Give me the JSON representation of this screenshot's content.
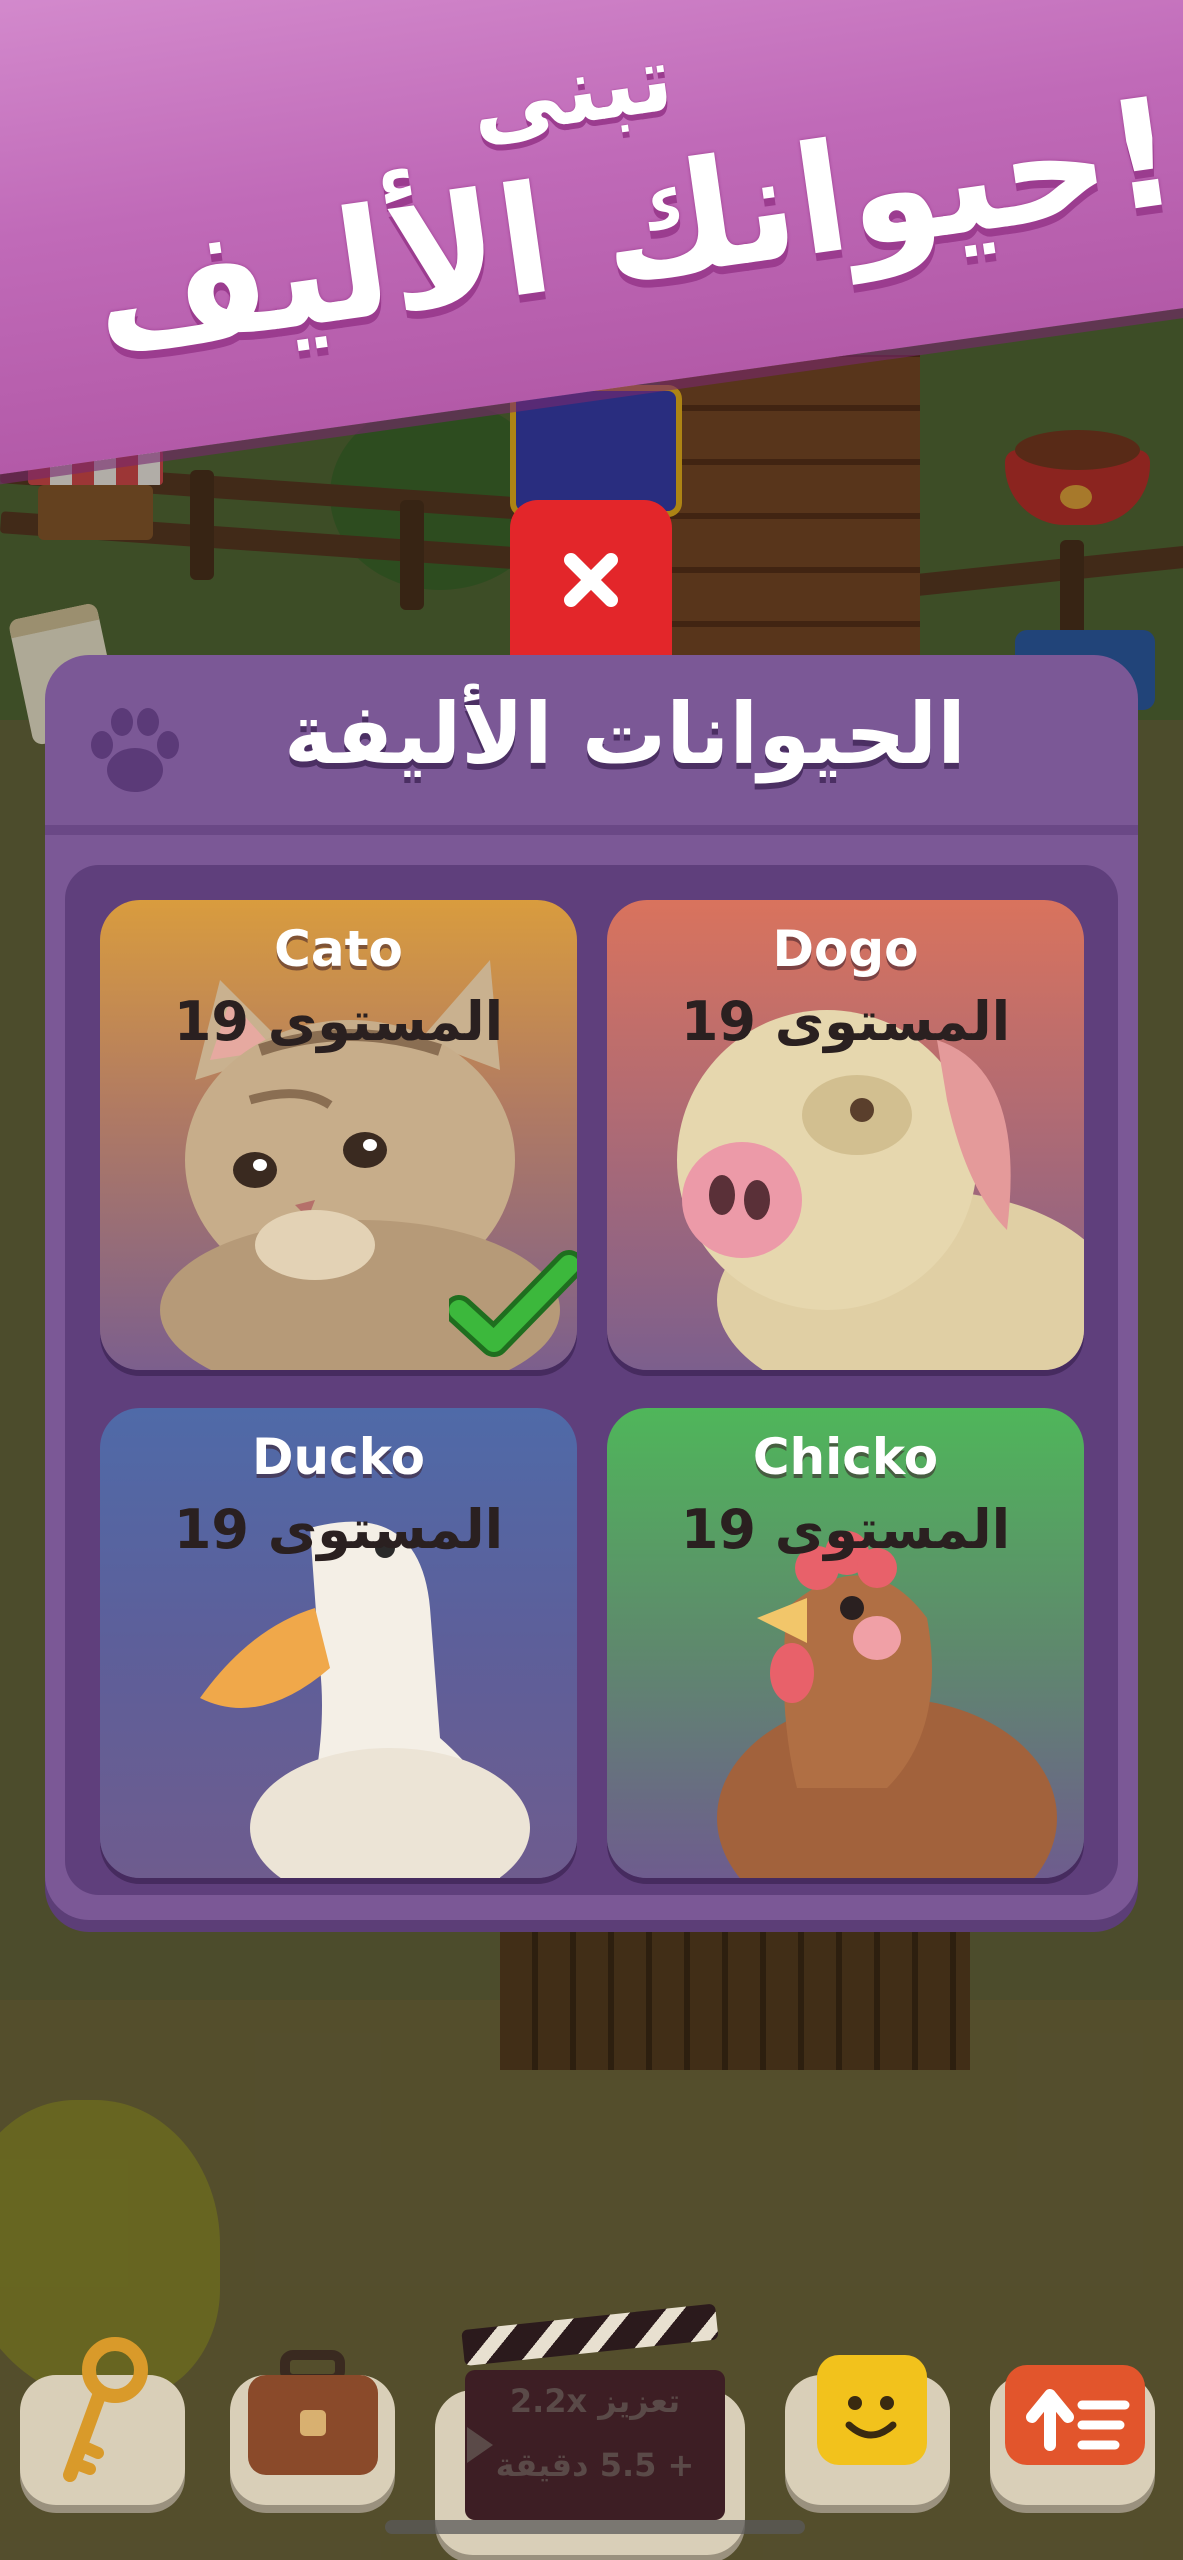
{
  "banner": {
    "line1": "تبنى",
    "line2": "حيوانك الأليف!"
  },
  "panel": {
    "title": "الحيوانات الأليفة"
  },
  "pets": [
    {
      "name": "Cato",
      "level": "المستوى 19",
      "selected": true
    },
    {
      "name": "Dogo",
      "level": "المستوى 19",
      "selected": false
    },
    {
      "name": "Ducko",
      "level": "المستوى 19",
      "selected": false
    },
    {
      "name": "Chicko",
      "level": "المستوى 19",
      "selected": false
    }
  ],
  "boost": {
    "line1": "تعزيز 2.2x",
    "line2": "+ 5.5 دقيقة"
  },
  "icons": {
    "close": "close-icon",
    "paw": "paw-icon",
    "check": "checkmark-icon",
    "key": "key-icon",
    "briefcase": "briefcase-icon",
    "emoji": "emoji-cube-icon",
    "upgrade": "upgrade-sign-icon",
    "clapper": "clapperboard-icon"
  },
  "colors": {
    "panel": "#7b5896",
    "banner": "#c06ab8",
    "close": "#e3262a",
    "check": "#3cb83c"
  }
}
